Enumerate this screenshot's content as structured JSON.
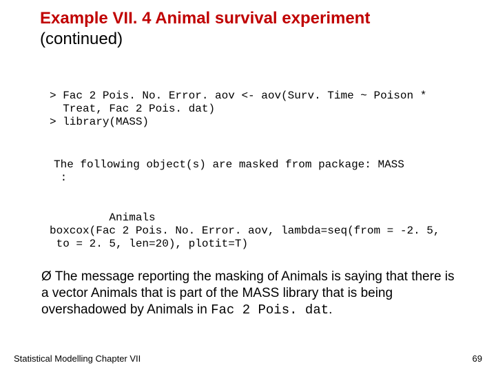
{
  "title": {
    "red": "Example VII. 4 Animal survival experiment",
    "cont": "(continued)"
  },
  "code": {
    "block1": "> Fac 2 Pois. No. Error. aov <- aov(Surv. Time ~ Poison *\n  Treat, Fac 2 Pois. dat)\n> library(MASS)",
    "maskmsg": "The following object(s) are masked from package: MASS\n :",
    "animals": "         Animals\nboxcox(Fac 2 Pois. No. Error. aov, lambda=seq(from = -2. 5,\n to = 2. 5, len=20), plotit=T)"
  },
  "bullet": {
    "marker": "Ø",
    "text_a": "The message reporting the masking of Animals is saying that there is a vector Animals that is part of the MASS library that is being overshadowed by Animals in ",
    "text_mono": "Fac 2 Pois. dat",
    "text_b": "."
  },
  "footer": {
    "left": "Statistical Modelling   Chapter VII",
    "right": "69"
  }
}
